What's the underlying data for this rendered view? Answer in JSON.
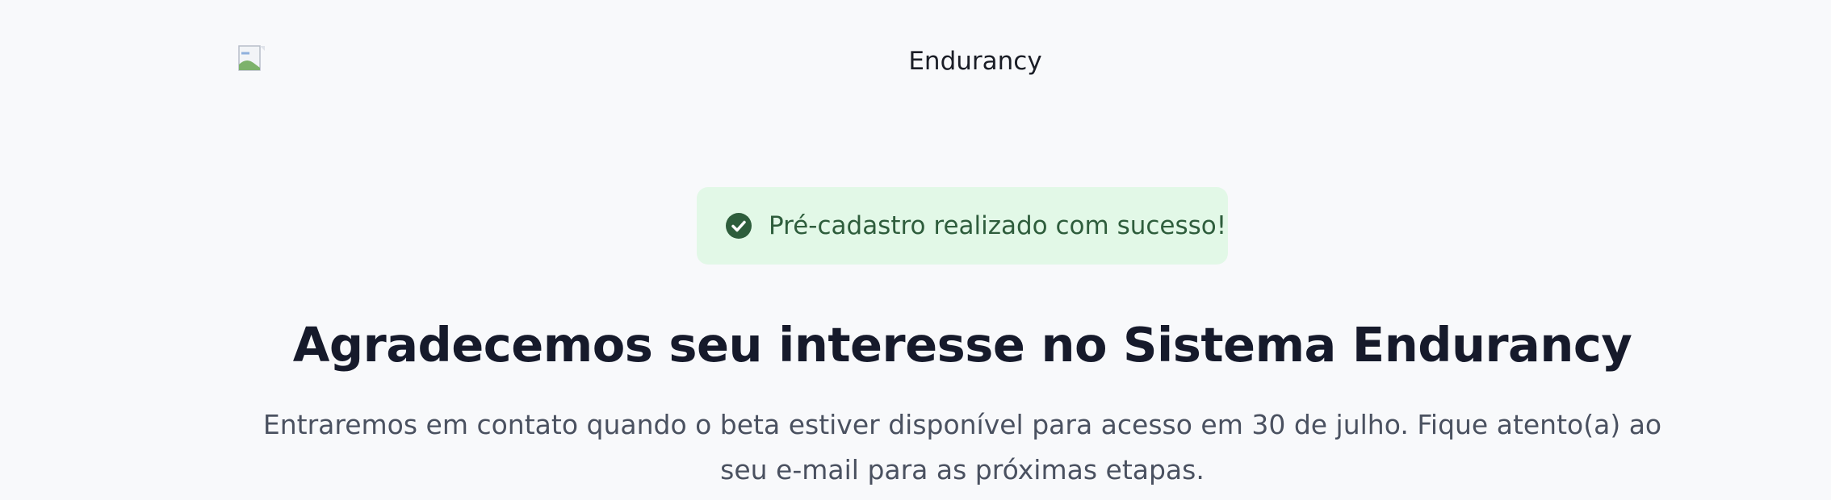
{
  "header": {
    "brand": "Endurancy",
    "logo_icon": "broken-image-icon"
  },
  "alert": {
    "icon": "check-circle-icon",
    "message": "Pré-cadastro realizado com sucesso!",
    "color": "#2e5d3c",
    "background": "#e2f8e7"
  },
  "main": {
    "title": "Agradecemos seu interesse no Sistema Endurancy",
    "subtitle": "Entraremos em contato quando o beta estiver disponível para acesso em 30 de julho. Fique atento(a) ao seu e-mail para as próximas etapas."
  }
}
